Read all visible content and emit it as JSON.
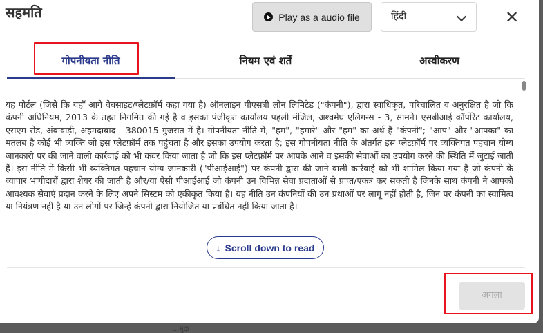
{
  "header": {
    "title": "सहमति",
    "audio_button_label": "Play as a audio file",
    "language_selected": "हिंदी",
    "close_symbol": "✕"
  },
  "tabs": [
    {
      "label": "गोपनीयता नीति",
      "active": true
    },
    {
      "label": "नियम एवं शर्तें",
      "active": false
    },
    {
      "label": "अस्वीकरण",
      "active": false
    }
  ],
  "content": {
    "policy_text": "यह पोर्टल (जिसे कि यहाँ आगे वेबसाइट/प्लेटफ़ॉर्म कहा गया है) ऑनलाइन पीएसबी लोन लिमिटेड (\"कंपनी\"), द्वारा स्वाधिकृत, परिचालित व अनुरक्षित है जो कि कंपनी अधिनियम, 2013 के तहत निगमित की गई है व इसका पंजीकृत कार्यालय पहली मंजिल, अश्वमेघ एलिगन्स - 3, सामने। एसबीआई कॉर्पोरेट कार्यालय, एसएम रोड, अंबावाड़ी, अहमदाबाद - 380015 गुजरात में है। गोपनीयता नीति में, \"हम\", \"हमारे\" और \"हम\" का अर्थ है \"कंपनी\"; \"आप\" और \"आपका\" का मतलब है कोई भी व्यक्ति जो इस प्लेटफ़ॉर्म तक पहुंचता है और इसका उपयोग करता है; इस गोपनीयता नीति के अंतर्गत इस प्लेटफ़ॉर्म पर व्यक्तिगत पहचान योग्य जानकारी पर की जाने वाली कार्रवाई को भी कवर किया जाता है जो कि इस प्लेटफ़ॉर्म पर आपके आने व इसकी सेवाओं का उपयोग करने की स्थिति में जुटाई जाती हैं। इस नीति में किसी भी व्यक्तिगत पहचान योग्य जानकारी (\"पीआईआई\") पर कंपनी द्वारा की जाने वाली कार्रवाई को भी शामिल किया गया है जो कंपनी के व्यापार भागीदारों द्वारा शेयर की जाती है और/या ऐसी पीआईआई जो कंपनी उन विभिन्न सेवा प्रदाताओं से प्राप्त/एकत्र कर सकती है जिनके साथ कंपनी ने आपको आवश्यक सेवाएं प्रदान करने के लिए अपने सिस्टम को एकीकृत किया है। यह नीति उन कंपनियों की उन प्रथाओं पर लागू नहीं होती है, जिन पर कंपनी का स्वामित्व या नियंत्रण नहीं है या उन लोगों पर जिन्हें कंपनी द्वारा नियोजित या प्रबंधित नहीं किया जाता है।",
    "scroll_hint": "Scroll down to read",
    "scroll_hint_arrow": "↓"
  },
  "footer": {
    "next_button_label": "अगला",
    "underlay_text": "...मुद्रा"
  },
  "colors": {
    "accent": "#2b3a8c",
    "highlight": "#e8141d",
    "disabled_button": "#e3e3e3"
  }
}
